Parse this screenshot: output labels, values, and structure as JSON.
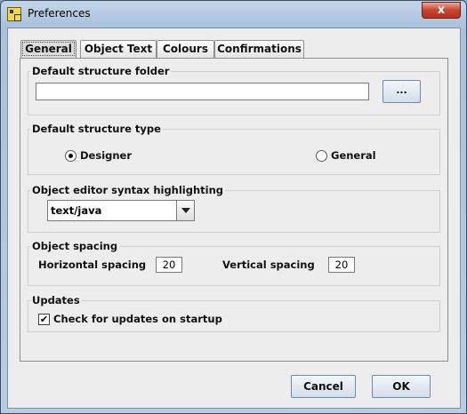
{
  "window": {
    "title": "Preferences",
    "close_symbol": "x"
  },
  "tabs": [
    {
      "label": "General",
      "active": true
    },
    {
      "label": "Object Text"
    },
    {
      "label": "Colours"
    },
    {
      "label": "Confirmations"
    }
  ],
  "default_folder": {
    "title": "Default structure folder",
    "value": "",
    "browse_label": "..."
  },
  "structure_type": {
    "title": "Default structure type",
    "selected": "Designer",
    "options": [
      "Designer",
      "General"
    ]
  },
  "syntax": {
    "title": "Object editor syntax highlighting",
    "value": "text/java"
  },
  "spacing": {
    "title": "Object spacing",
    "horizontal_label": "Horizontal spacing",
    "horizontal_value": "20",
    "vertical_label": "Vertical spacing",
    "vertical_value": "20"
  },
  "updates": {
    "title": "Updates",
    "check_label": "Check for updates on startup",
    "check_mark": "✔",
    "checked": true
  },
  "buttons": {
    "cancel": "Cancel",
    "ok": "OK"
  }
}
